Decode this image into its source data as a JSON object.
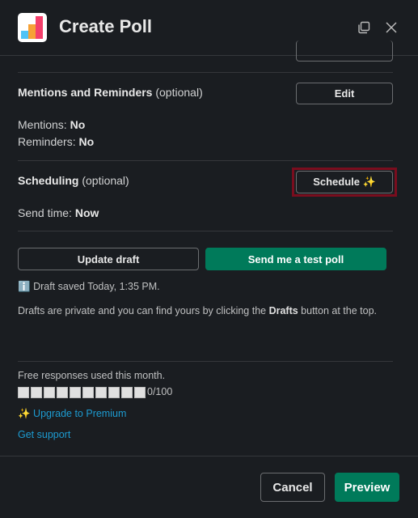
{
  "header": {
    "title": "Create Poll",
    "icons": [
      "expand-icon",
      "close-icon"
    ]
  },
  "mentions": {
    "title": "Mentions and Reminders",
    "optional": "(optional)",
    "edit_label": "Edit",
    "mentions_label": "Mentions:",
    "mentions_value": "No",
    "reminders_label": "Reminders:",
    "reminders_value": "No"
  },
  "scheduling": {
    "title": "Scheduling",
    "optional": "(optional)",
    "schedule_label": "Schedule ✨",
    "send_time_label": "Send time:",
    "send_time_value": "Now"
  },
  "actions": {
    "update_draft": "Update draft",
    "send_test": "Send me a test poll"
  },
  "draft": {
    "info_icon": "ℹ️",
    "saved": "Draft saved Today, 1:35 PM.",
    "note_pre": "Drafts are private and you can find yours by clicking the ",
    "note_bold": "Drafts",
    "note_post": " button at the top."
  },
  "usage": {
    "label": "Free responses used this month.",
    "used": 0,
    "total": 100,
    "count_text": "0/100"
  },
  "links": {
    "upgrade": "✨ Upgrade to Premium",
    "support": "Get support"
  },
  "footer": {
    "cancel": "Cancel",
    "preview": "Preview"
  },
  "colors": {
    "accent": "#007a5a",
    "link": "#1d9bd1",
    "highlight": "#7a0d1e"
  }
}
